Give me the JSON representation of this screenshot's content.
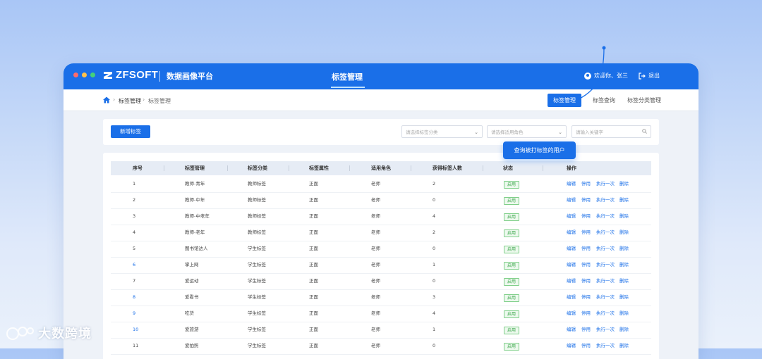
{
  "app": {
    "brand": "ZFSOFT",
    "platform_name": "数据画像平台",
    "page_title": "标签管理",
    "welcome": "欢迎你、张三",
    "logout": "退出"
  },
  "breadcrumb": {
    "level1": "标签管理",
    "level2": "标签管理"
  },
  "nav": {
    "tag_manage": "标签管理",
    "tag_query": "标签查询",
    "tag_category": "标签分类管理"
  },
  "toolbar": {
    "add_label": "新增标签",
    "category_placeholder": "请选择标签分类",
    "role_placeholder": "请选择适用角色",
    "keyword_placeholder": "请输入关键字"
  },
  "tooltip": "查询被打标签的用户",
  "table": {
    "headers": [
      "序号",
      "标签管理",
      "标签分类",
      "标签属性",
      "适用角色",
      "获得标签人数",
      "状态",
      "操作"
    ],
    "rows": [
      [
        "1",
        "教师-青年",
        "教师标签",
        "正面",
        "老师",
        "2",
        "启用"
      ],
      [
        "2",
        "教师-中年",
        "教师标签",
        "正面",
        "老师",
        "0",
        "启用"
      ],
      [
        "3",
        "教师-中老年",
        "教师标签",
        "正面",
        "老师",
        "4",
        "启用"
      ],
      [
        "4",
        "教师-老年",
        "教师标签",
        "正面",
        "老师",
        "2",
        "启用"
      ],
      [
        "5",
        "图书馆达人",
        "学生标签",
        "正面",
        "老师",
        "0",
        "启用"
      ],
      [
        "6",
        "掌上网",
        "学生标签",
        "正面",
        "老师",
        "1",
        "启用"
      ],
      [
        "7",
        "爱运动",
        "学生标签",
        "正面",
        "老师",
        "0",
        "启用"
      ],
      [
        "8",
        "爱看书",
        "学生标签",
        "正面",
        "老师",
        "3",
        "启用"
      ],
      [
        "9",
        "吃货",
        "学生标签",
        "正面",
        "老师",
        "4",
        "启用"
      ],
      [
        "10",
        "爱旅游",
        "学生标签",
        "正面",
        "老师",
        "1",
        "启用"
      ],
      [
        "11",
        "爱拍照",
        "学生标签",
        "正面",
        "老师",
        "0",
        "启用"
      ]
    ],
    "actions": [
      "编辑",
      "停用",
      "执行一次",
      "删除"
    ]
  },
  "watermark": "大数跨境",
  "colors": {
    "primary": "#1a6fe8",
    "success": "#3aa64a"
  }
}
